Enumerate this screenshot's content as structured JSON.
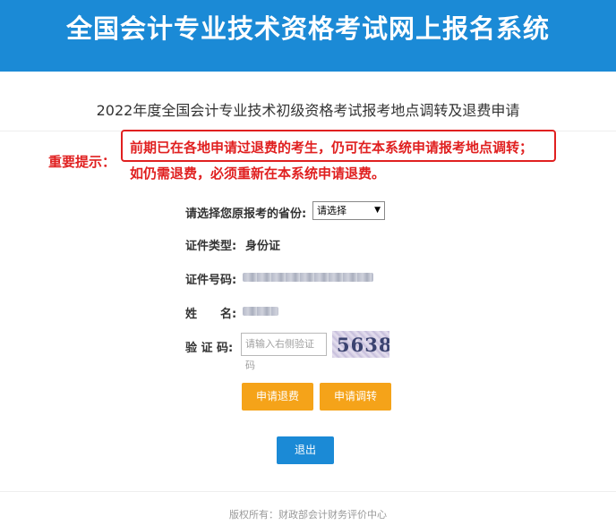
{
  "header": {
    "title": "全国会计专业技术资格考试网上报名系统"
  },
  "page": {
    "subtitle": "2022年度全国会计专业技术初级资格考试报考地点调转及退费申请"
  },
  "notice": {
    "label": "重要提示：",
    "line1": "前期已在各地申请过退费的考生，仍可在本系统申请报考地点调转；",
    "line2": "如仍需退费，必须重新在本系统申请退费。"
  },
  "form": {
    "province_label": "请选择您原报考的省份:",
    "province_selected": "请选择",
    "id_type_label": "证件类型:",
    "id_type_value": "身份证",
    "id_number_label": "证件号码:",
    "name_label": "姓　　名:",
    "captcha_label": "验 证 码:",
    "captcha_placeholder": "请输入右侧验证码",
    "captcha_image_text": "5638"
  },
  "buttons": {
    "refund": "申请退费",
    "transfer": "申请调转",
    "exit": "退出"
  },
  "footer": {
    "text": "版权所有：财政部会计财务评价中心"
  },
  "colors": {
    "header_bg": "#1b8ad6",
    "notice_red": "#e02020",
    "button_orange": "#f5a319",
    "button_blue": "#1b8ad6"
  }
}
